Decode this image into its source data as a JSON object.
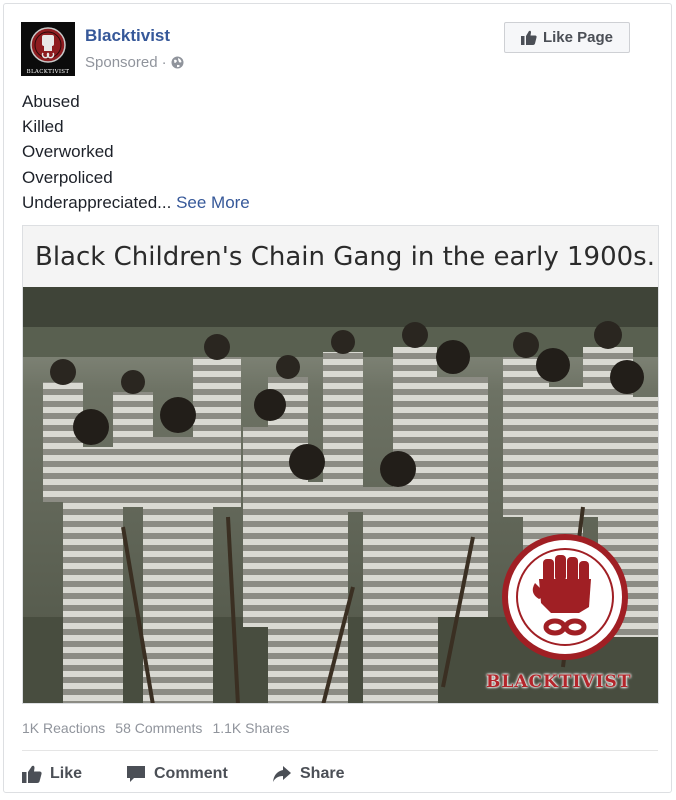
{
  "post": {
    "page_name": "Blacktivist",
    "avatar_word": "BLACKTIVIST",
    "sponsored_label": "Sponsored",
    "meta_separator": "·",
    "like_page_label": "Like Page",
    "text_lines": [
      "Abused",
      "Killed",
      "Overworked",
      "Overpoliced",
      "Underappreciated..."
    ],
    "see_more": "See More"
  },
  "media": {
    "caption": "Black Children's Chain Gang in the early 1900s.",
    "watermark_text": "BLACKTIVIST"
  },
  "stats": {
    "reactions": "1K Reactions",
    "comments": "58 Comments",
    "shares": "1.1K Shares"
  },
  "actions": {
    "like": "Like",
    "comment": "Comment",
    "share": "Share"
  },
  "icons": {
    "globe": "globe-icon",
    "thumbs_up": "thumbs-up-icon",
    "comment": "comment-bubble-icon",
    "share": "share-arrow-icon",
    "fist": "raised-fist-icon"
  },
  "colors": {
    "link_blue": "#365899",
    "brand_red": "#b3262b",
    "muted_gray": "#90949c"
  }
}
